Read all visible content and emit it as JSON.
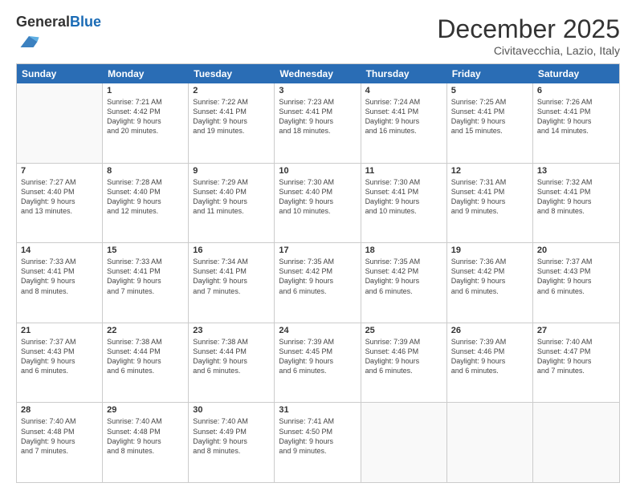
{
  "logo": {
    "general": "General",
    "blue": "Blue"
  },
  "title": "December 2025",
  "subtitle": "Civitavecchia, Lazio, Italy",
  "days": [
    "Sunday",
    "Monday",
    "Tuesday",
    "Wednesday",
    "Thursday",
    "Friday",
    "Saturday"
  ],
  "weeks": [
    [
      {
        "day": "",
        "info": ""
      },
      {
        "day": "1",
        "info": "Sunrise: 7:21 AM\nSunset: 4:42 PM\nDaylight: 9 hours\nand 20 minutes."
      },
      {
        "day": "2",
        "info": "Sunrise: 7:22 AM\nSunset: 4:41 PM\nDaylight: 9 hours\nand 19 minutes."
      },
      {
        "day": "3",
        "info": "Sunrise: 7:23 AM\nSunset: 4:41 PM\nDaylight: 9 hours\nand 18 minutes."
      },
      {
        "day": "4",
        "info": "Sunrise: 7:24 AM\nSunset: 4:41 PM\nDaylight: 9 hours\nand 16 minutes."
      },
      {
        "day": "5",
        "info": "Sunrise: 7:25 AM\nSunset: 4:41 PM\nDaylight: 9 hours\nand 15 minutes."
      },
      {
        "day": "6",
        "info": "Sunrise: 7:26 AM\nSunset: 4:41 PM\nDaylight: 9 hours\nand 14 minutes."
      }
    ],
    [
      {
        "day": "7",
        "info": "Sunrise: 7:27 AM\nSunset: 4:40 PM\nDaylight: 9 hours\nand 13 minutes."
      },
      {
        "day": "8",
        "info": "Sunrise: 7:28 AM\nSunset: 4:40 PM\nDaylight: 9 hours\nand 12 minutes."
      },
      {
        "day": "9",
        "info": "Sunrise: 7:29 AM\nSunset: 4:40 PM\nDaylight: 9 hours\nand 11 minutes."
      },
      {
        "day": "10",
        "info": "Sunrise: 7:30 AM\nSunset: 4:40 PM\nDaylight: 9 hours\nand 10 minutes."
      },
      {
        "day": "11",
        "info": "Sunrise: 7:30 AM\nSunset: 4:41 PM\nDaylight: 9 hours\nand 10 minutes."
      },
      {
        "day": "12",
        "info": "Sunrise: 7:31 AM\nSunset: 4:41 PM\nDaylight: 9 hours\nand 9 minutes."
      },
      {
        "day": "13",
        "info": "Sunrise: 7:32 AM\nSunset: 4:41 PM\nDaylight: 9 hours\nand 8 minutes."
      }
    ],
    [
      {
        "day": "14",
        "info": "Sunrise: 7:33 AM\nSunset: 4:41 PM\nDaylight: 9 hours\nand 8 minutes."
      },
      {
        "day": "15",
        "info": "Sunrise: 7:33 AM\nSunset: 4:41 PM\nDaylight: 9 hours\nand 7 minutes."
      },
      {
        "day": "16",
        "info": "Sunrise: 7:34 AM\nSunset: 4:41 PM\nDaylight: 9 hours\nand 7 minutes."
      },
      {
        "day": "17",
        "info": "Sunrise: 7:35 AM\nSunset: 4:42 PM\nDaylight: 9 hours\nand 6 minutes."
      },
      {
        "day": "18",
        "info": "Sunrise: 7:35 AM\nSunset: 4:42 PM\nDaylight: 9 hours\nand 6 minutes."
      },
      {
        "day": "19",
        "info": "Sunrise: 7:36 AM\nSunset: 4:42 PM\nDaylight: 9 hours\nand 6 minutes."
      },
      {
        "day": "20",
        "info": "Sunrise: 7:37 AM\nSunset: 4:43 PM\nDaylight: 9 hours\nand 6 minutes."
      }
    ],
    [
      {
        "day": "21",
        "info": "Sunrise: 7:37 AM\nSunset: 4:43 PM\nDaylight: 9 hours\nand 6 minutes."
      },
      {
        "day": "22",
        "info": "Sunrise: 7:38 AM\nSunset: 4:44 PM\nDaylight: 9 hours\nand 6 minutes."
      },
      {
        "day": "23",
        "info": "Sunrise: 7:38 AM\nSunset: 4:44 PM\nDaylight: 9 hours\nand 6 minutes."
      },
      {
        "day": "24",
        "info": "Sunrise: 7:39 AM\nSunset: 4:45 PM\nDaylight: 9 hours\nand 6 minutes."
      },
      {
        "day": "25",
        "info": "Sunrise: 7:39 AM\nSunset: 4:46 PM\nDaylight: 9 hours\nand 6 minutes."
      },
      {
        "day": "26",
        "info": "Sunrise: 7:39 AM\nSunset: 4:46 PM\nDaylight: 9 hours\nand 6 minutes."
      },
      {
        "day": "27",
        "info": "Sunrise: 7:40 AM\nSunset: 4:47 PM\nDaylight: 9 hours\nand 7 minutes."
      }
    ],
    [
      {
        "day": "28",
        "info": "Sunrise: 7:40 AM\nSunset: 4:48 PM\nDaylight: 9 hours\nand 7 minutes."
      },
      {
        "day": "29",
        "info": "Sunrise: 7:40 AM\nSunset: 4:48 PM\nDaylight: 9 hours\nand 8 minutes."
      },
      {
        "day": "30",
        "info": "Sunrise: 7:40 AM\nSunset: 4:49 PM\nDaylight: 9 hours\nand 8 minutes."
      },
      {
        "day": "31",
        "info": "Sunrise: 7:41 AM\nSunset: 4:50 PM\nDaylight: 9 hours\nand 9 minutes."
      },
      {
        "day": "",
        "info": ""
      },
      {
        "day": "",
        "info": ""
      },
      {
        "day": "",
        "info": ""
      }
    ]
  ]
}
